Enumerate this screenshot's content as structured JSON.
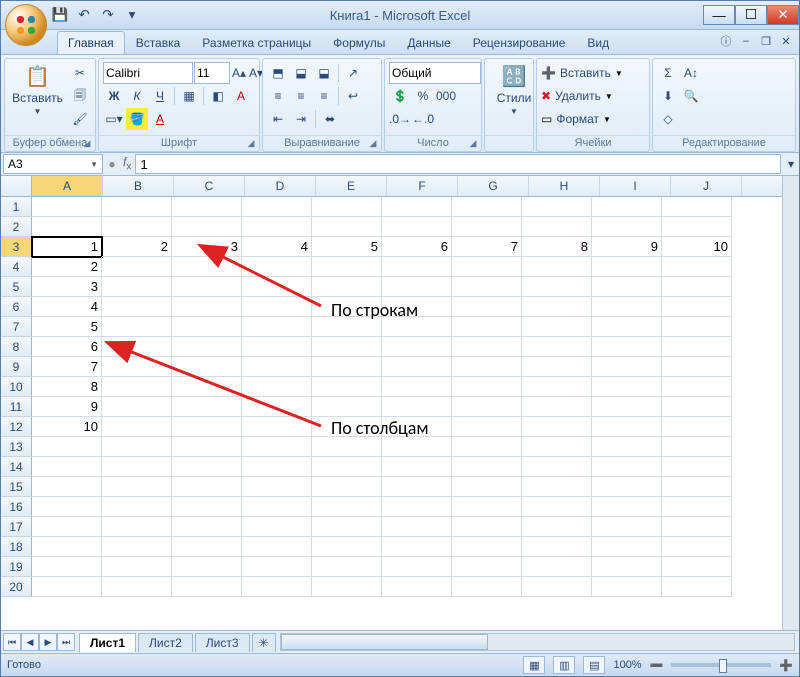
{
  "title": "Книга1 - Microsoft Excel",
  "qat": {
    "save": "💾",
    "undo": "↶",
    "redo": "↷",
    "more": "▾"
  },
  "tabs": [
    "Главная",
    "Вставка",
    "Разметка страницы",
    "Формулы",
    "Данные",
    "Рецензирование",
    "Вид"
  ],
  "active_tab": 0,
  "ribbon": {
    "clipboard": {
      "paste": "Вставить",
      "label": "Буфер обмена"
    },
    "font": {
      "name": "Calibri",
      "size": "11",
      "label": "Шрифт"
    },
    "align": {
      "label": "Выравнивание"
    },
    "number": {
      "format": "Общий",
      "label": "Число"
    },
    "styles": {
      "btn": "Стили"
    },
    "cells": {
      "insert": "Вставить",
      "delete": "Удалить",
      "format": "Формат",
      "label": "Ячейки"
    },
    "editing": {
      "label": "Редактирование"
    }
  },
  "namebox": "A3",
  "formula": "1",
  "columns": [
    "A",
    "B",
    "C",
    "D",
    "E",
    "F",
    "G",
    "H",
    "I",
    "J"
  ],
  "active_col": 0,
  "row_count": 20,
  "active_row": 3,
  "cells": {
    "3": {
      "A": "1",
      "B": "2",
      "C": "3",
      "D": "4",
      "E": "5",
      "F": "6",
      "G": "7",
      "H": "8",
      "I": "9",
      "J": "10"
    },
    "4": {
      "A": "2"
    },
    "5": {
      "A": "3"
    },
    "6": {
      "A": "4"
    },
    "7": {
      "A": "5"
    },
    "8": {
      "A": "6"
    },
    "9": {
      "A": "7"
    },
    "10": {
      "A": "8"
    },
    "11": {
      "A": "9"
    },
    "12": {
      "A": "10"
    }
  },
  "annotations": {
    "rows_label": "По строкам",
    "cols_label": "По столбцам"
  },
  "sheets": [
    "Лист1",
    "Лист2",
    "Лист3"
  ],
  "active_sheet": 0,
  "status": {
    "ready": "Готово",
    "zoom": "100%"
  }
}
